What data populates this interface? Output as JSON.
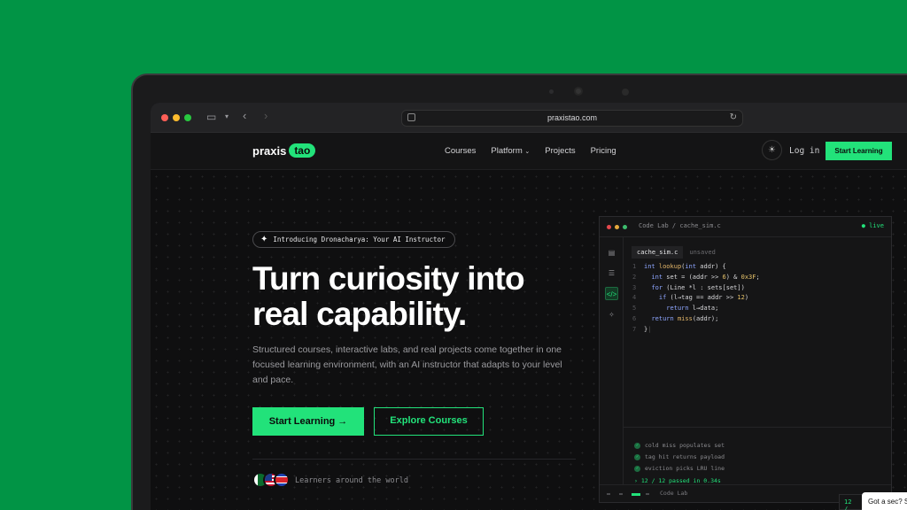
{
  "browser": {
    "url": "praxistao.com",
    "traffic_lights": [
      "#ff5f57",
      "#febc2e",
      "#28c840"
    ]
  },
  "nav": {
    "logo_word": "praxis",
    "logo_pill": "tao",
    "links": [
      "Courses",
      "Platform",
      "Projects",
      "Pricing"
    ],
    "platform_chevron": "chevron-down-icon",
    "login": "Log in",
    "cta": "Start Learning"
  },
  "hero": {
    "badge": "Introducing Dronacharya: Your AI Instructor",
    "title_line1": "Turn curiosity into",
    "title_line2": "real capability.",
    "subtitle": "Structured courses, interactive labs, and real projects come together in one focused learning environment, with an AI instructor that adapts to your level and pace.",
    "primary_button": "Start Learning →",
    "secondary_button": "Explore Courses",
    "learners_text": "Learners around the world"
  },
  "code_panel": {
    "breadcrumb": "Code Lab / cache_sim.c",
    "live": "● live",
    "file_tab": "cache_sim.c",
    "file_status": "unsaved",
    "line_numbers": [
      "1",
      "2",
      "3",
      "4",
      "5",
      "6",
      "7"
    ],
    "tests": [
      "cold miss populates set",
      "tag hit returns payload",
      "eviction picks LRU line"
    ],
    "summary": "› 12 / 12 passed in 0.34s",
    "footer_label": "Code Lab"
  },
  "overlay": {
    "counter": "12 /",
    "chat": "Got a sec? S"
  },
  "colors": {
    "accent": "#22e27a",
    "background": "#019445",
    "page_dark": "#0f0f10"
  }
}
